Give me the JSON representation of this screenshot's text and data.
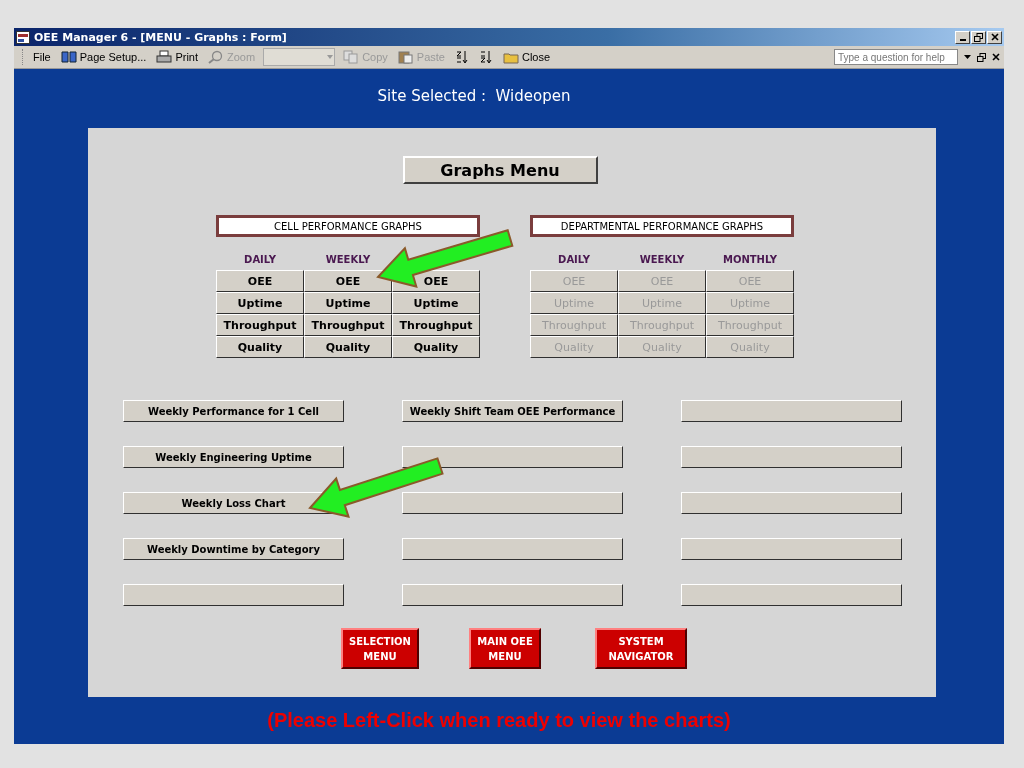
{
  "window": {
    "title": "OEE Manager 6 - [MENU - Graphs : Form]"
  },
  "toolbar": [
    {
      "kind": "menu",
      "label": "File",
      "disabled": false
    },
    {
      "kind": "book",
      "label": "Page Setup...",
      "disabled": false
    },
    {
      "kind": "printer",
      "label": "Print",
      "disabled": false
    },
    {
      "kind": "zoom",
      "label": "Zoom",
      "disabled": true
    },
    {
      "kind": "combo",
      "disabled": true
    },
    {
      "kind": "copy",
      "label": "Copy",
      "disabled": true
    },
    {
      "kind": "paste",
      "label": "Paste",
      "disabled": true
    },
    {
      "kind": "sort-asc",
      "disabled": false
    },
    {
      "kind": "sort-desc",
      "disabled": false
    },
    {
      "kind": "folder",
      "label": "Close",
      "disabled": false
    }
  ],
  "help": {
    "placeholder": "Type a question for help"
  },
  "site": "Site Selected :  Wideopen",
  "menu_title": "Graphs Menu",
  "groups": [
    {
      "title": "CELL PERFORMANCE GRAPHS",
      "disabled": false,
      "columns": [
        {
          "header": "DAILY",
          "buttons": [
            "OEE",
            "Uptime",
            "Throughput",
            "Quality"
          ]
        },
        {
          "header": "WEEKLY",
          "buttons": [
            "OEE",
            "Uptime",
            "Throughput",
            "Quality"
          ]
        },
        {
          "buttons": [
            "OEE",
            "Uptime",
            "Throughput",
            "Quality"
          ]
        }
      ]
    },
    {
      "title": "DEPARTMENTAL PERFORMANCE GRAPHS",
      "disabled": true,
      "columns": [
        {
          "header": "DAILY",
          "buttons": [
            "OEE",
            "Uptime",
            "Throughput",
            "Quality"
          ]
        },
        {
          "header": "WEEKLY",
          "buttons": [
            "OEE",
            "Uptime",
            "Throughput",
            "Quality"
          ]
        },
        {
          "header": "MONTHLY",
          "buttons": [
            "OEE",
            "Uptime",
            "Throughput",
            "Quality"
          ]
        }
      ]
    }
  ],
  "report_buttons": [
    {
      "kind": "labeled",
      "label": "Weekly Performance for 1 Cell"
    },
    {
      "kind": "labeled",
      "label": "Weekly Shift Team OEE Performance"
    },
    {
      "kind": "blank"
    },
    {
      "kind": "labeled",
      "label": "Weekly Engineering Uptime"
    },
    {
      "kind": "blank"
    },
    {
      "kind": "blank"
    },
    {
      "kind": "labeled",
      "label": "Weekly Loss Chart"
    },
    {
      "kind": "blank"
    },
    {
      "kind": "blank"
    },
    {
      "kind": "labeled",
      "label": "Weekly Downtime by Category"
    },
    {
      "kind": "blank"
    },
    {
      "kind": "blank"
    },
    {
      "kind": "blank"
    },
    {
      "kind": "blank"
    },
    {
      "kind": "blank"
    }
  ],
  "nav_buttons": [
    "SELECTION\nMENU",
    "MAIN OEE\nMENU",
    "SYSTEM\nNAVIGATOR"
  ],
  "footer": "(Please Left-Click when ready to view the charts)"
}
